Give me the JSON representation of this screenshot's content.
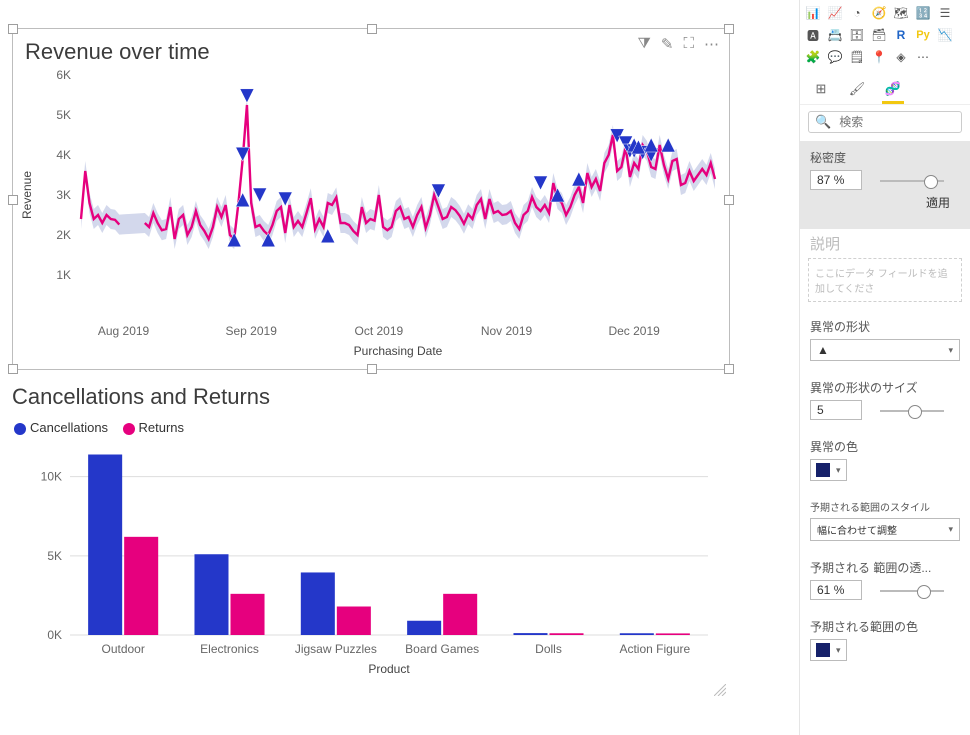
{
  "chart_data": [
    {
      "type": "line",
      "title": "Revenue over time",
      "xlabel": "Purchasing Date",
      "ylabel": "Revenue",
      "ylim": [
        0,
        6000
      ],
      "yticks": [
        1000,
        2000,
        3000,
        4000,
        5000,
        6000
      ],
      "ytick_labels": [
        "1K",
        "2K",
        "3K",
        "4K",
        "5K",
        "6K"
      ],
      "xtick_labels": [
        "Aug 2019",
        "Sep 2019",
        "Oct 2019",
        "Nov 2019",
        "Dec 2019"
      ],
      "xtick_idx": [
        10,
        40,
        70,
        100,
        130
      ],
      "series": [
        {
          "name": "Revenue",
          "color": "#e6007e",
          "values": [
            2400,
            3600,
            2800,
            2400,
            2500,
            2300,
            2500,
            2400,
            2380,
            2260,
            null,
            null,
            null,
            null,
            null,
            2300,
            2200,
            2550,
            2300,
            2120,
            2150,
            2700,
            1900,
            2400,
            2500,
            2000,
            2200,
            2600,
            2250,
            2100,
            1900,
            2200,
            2700,
            2450,
            2750,
            2000,
            1900,
            2800,
            3900,
            5250,
            2800,
            2200,
            2250,
            2100,
            2000,
            2250,
            2600,
            2700,
            2050,
            2750,
            2200,
            2350,
            2200,
            2550,
            2920,
            2150,
            2400,
            2200,
            2800,
            2750,
            2940,
            2300,
            2300,
            2250,
            2100,
            2000,
            2700,
            2300,
            2400,
            2360,
            3000,
            2200,
            2120,
            2200,
            2600,
            2700,
            2400,
            2450,
            2200,
            2500,
            2700,
            2180,
            2500,
            3000,
            2700,
            2400,
            2450,
            2700,
            2620,
            2480,
            2280,
            2520,
            2400,
            2750,
            2900,
            2400,
            2900,
            2550,
            2600,
            2500,
            2520,
            2600,
            2300,
            2150,
            2500,
            2600,
            2950,
            2700,
            2600,
            2750,
            2550,
            3300,
            2900,
            2800,
            2500,
            2700,
            3000,
            3200,
            2800,
            3550,
            3200,
            3400,
            3100,
            3800,
            4000,
            4500,
            3600,
            3700,
            4200,
            3450,
            3800,
            3650,
            4250,
            4100,
            3700,
            3650,
            4250,
            3750,
            3400,
            3850,
            3900,
            3250,
            3300,
            3600,
            3350,
            3500,
            3650,
            3500,
            3800,
            3400
          ]
        }
      ],
      "anomalies_up": [
        [
          36,
          1880
        ],
        [
          38,
          2880
        ],
        [
          44,
          1880
        ],
        [
          58,
          1980
        ],
        [
          112,
          3000
        ],
        [
          117,
          3400
        ],
        [
          130,
          4250
        ],
        [
          131,
          4200
        ],
        [
          134,
          4250
        ],
        [
          138,
          4250
        ]
      ],
      "anomalies_down": [
        [
          38,
          4020
        ],
        [
          39,
          5480
        ],
        [
          42,
          3000
        ],
        [
          48,
          2900
        ],
        [
          84,
          3100
        ],
        [
          108,
          3300
        ],
        [
          126,
          4480
        ],
        [
          128,
          4300
        ],
        [
          129,
          4100
        ],
        [
          130,
          4100
        ],
        [
          132,
          4060
        ],
        [
          134,
          4000
        ]
      ]
    },
    {
      "type": "bar",
      "title": "Cancellations and Returns",
      "xlabel": "Product",
      "ylabel": "",
      "ylim": [
        0,
        12000
      ],
      "yticks": [
        0,
        5000,
        10000
      ],
      "ytick_labels": [
        "0K",
        "5K",
        "10K"
      ],
      "categories": [
        "Outdoor",
        "Electronics",
        "Jigsaw Puzzles",
        "Board Games",
        "Dolls",
        "Action Figure"
      ],
      "series": [
        {
          "name": "Cancellations",
          "color": "#2437c9",
          "values": [
            11400,
            5100,
            3950,
            900,
            120,
            110
          ]
        },
        {
          "name": "Returns",
          "color": "#e6007e",
          "values": [
            6200,
            2600,
            1800,
            2600,
            110,
            100
          ]
        }
      ]
    }
  ],
  "visualHover": {
    "filter": "⧩",
    "pencil": "✎",
    "focus": "⛶",
    "more": "⋯"
  },
  "sidePanel": {
    "vizIcons": [
      "📊",
      "📈",
      "◔",
      "🧭",
      "🗺",
      "🔢",
      "☰",
      "🅰",
      "📇",
      "🗄",
      "🗃",
      "R",
      "Py",
      "📉",
      "🧩",
      "💬",
      "🗒",
      "📍",
      "◈",
      "⋯"
    ],
    "tabs": {
      "fields": "⊞",
      "format": "🖌",
      "analytics": "🧬"
    },
    "search": {
      "placeholder": "検索"
    },
    "sensitivity": {
      "label": "秘密度",
      "value": "87",
      "unit": "%",
      "sliderPos": 0.85,
      "apply": "適用"
    },
    "explanation": {
      "label": "説明",
      "drop": "ここにデータ フィールドを追加してくださ"
    },
    "anomalyShape": {
      "label": "異常の形状",
      "value": "▲"
    },
    "anomalyShapeSize": {
      "label": "異常の形状のサイズ",
      "value": "5",
      "sliderPos": 0.55
    },
    "anomalyColor": {
      "label": "異常の色",
      "color": "#16216a"
    },
    "expectedStyle": {
      "label": "予期される範囲のスタイル",
      "value": "幅に合わせて調整"
    },
    "expectedOpacity": {
      "label": "予期される 範囲の透...",
      "value": "61",
      "unit": "%",
      "sliderPos": 0.72
    },
    "expectedColor": {
      "label": "予期される範囲の色",
      "color": "#16216a"
    }
  }
}
